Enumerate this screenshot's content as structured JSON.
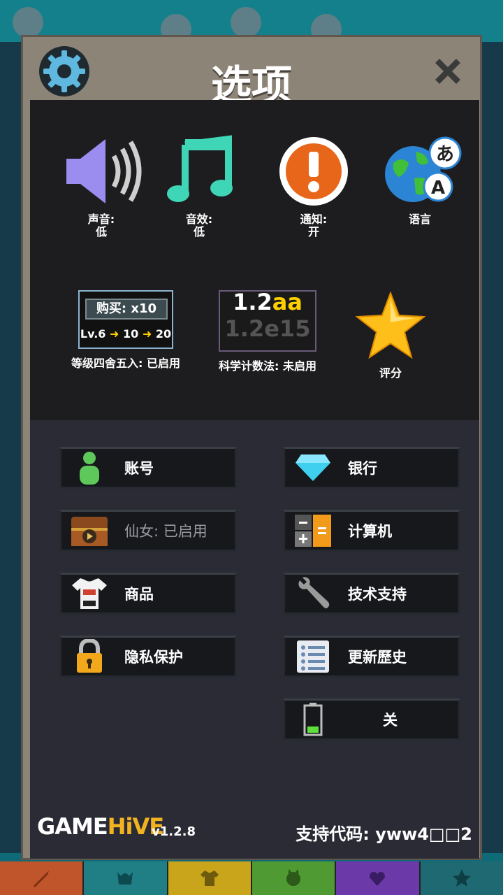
{
  "dialog": {
    "title": "选项"
  },
  "options_row1": [
    {
      "label": "声音:",
      "value": "低",
      "icon": "speaker-icon"
    },
    {
      "label": "音效:",
      "value": "低",
      "icon": "music-note-icon"
    },
    {
      "label": "通知:",
      "value": "开",
      "icon": "alert-icon"
    },
    {
      "label": "语言",
      "value": "",
      "icon": "globe-language-icon"
    }
  ],
  "rounding": {
    "buy_text": "购买: x10",
    "lv_text": "Lv.6",
    "lv_mid": "10",
    "lv_end": "20",
    "label": "等级四舍五入: 已启用"
  },
  "scientific": {
    "sample_a_num": "1.2",
    "sample_a_suffix": "aa",
    "sample_b": "1.2e15",
    "label": "科学计数法: 未启用"
  },
  "rating": {
    "label": "评分",
    "icon": "star-icon"
  },
  "menu_buttons": {
    "account": "账号",
    "bank": "银行",
    "fairy": "仙女: 已启用",
    "calculator": "计算机",
    "merch": "商品",
    "support": "技术支持",
    "privacy": "隐私保护",
    "changelog": "更新歷史",
    "battery": "关"
  },
  "footer": {
    "logo_game": "GAME",
    "logo_hive": "HiVE",
    "version": "v1.2.8",
    "support_code": "支持代码: yww4□□2"
  },
  "colors": {
    "panel": "#8d8478",
    "accent_yellow": "#ffd000",
    "speaker": "#9b8cf0",
    "music": "#3fd6b8",
    "alert": "#e8661a"
  }
}
